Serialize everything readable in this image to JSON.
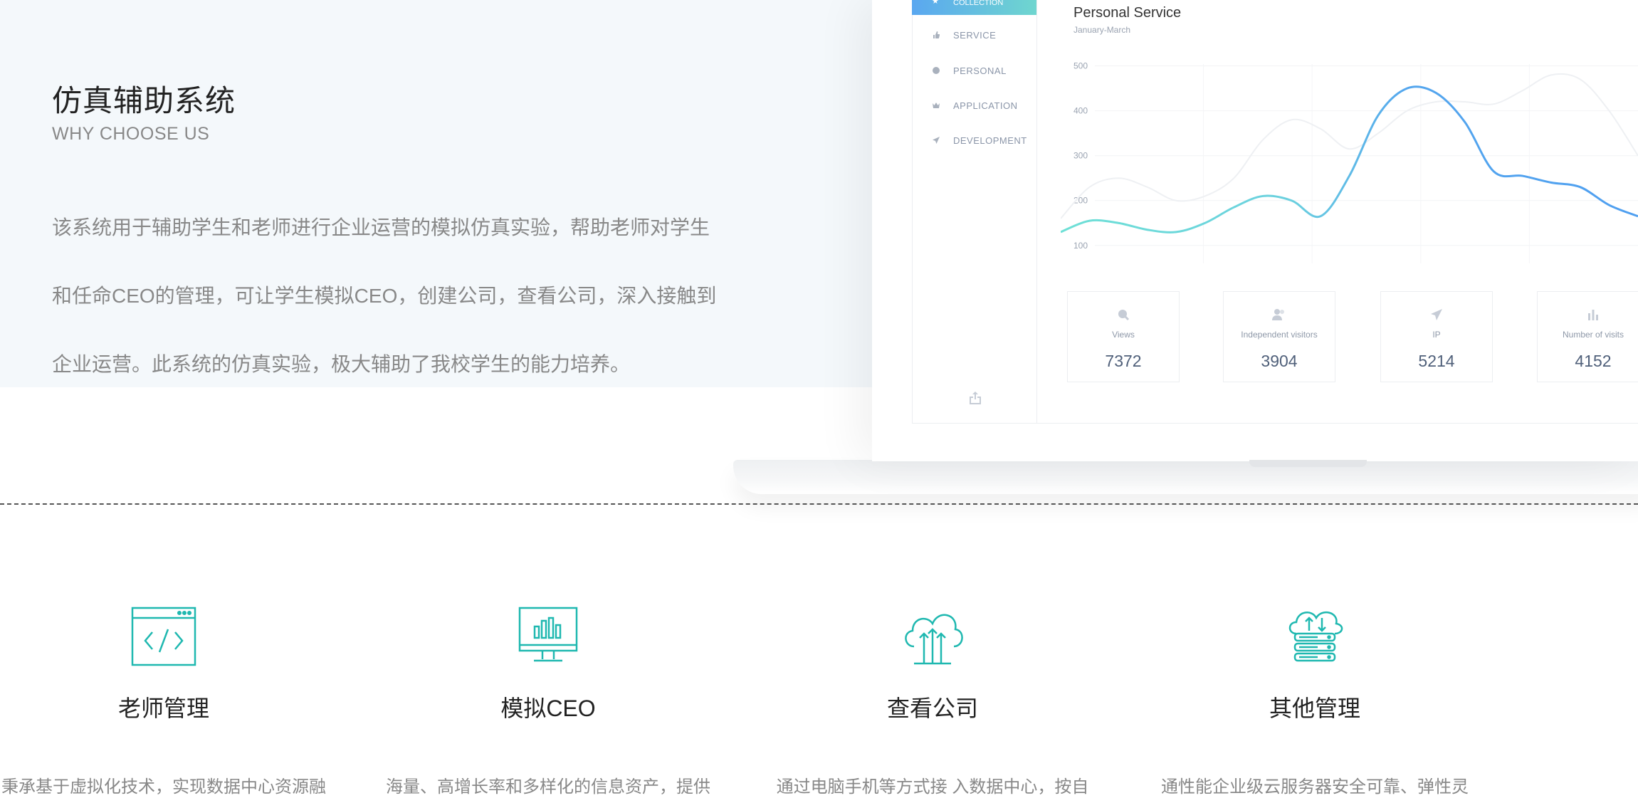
{
  "hero": {
    "title": "仿真辅助系统",
    "subtitle": "WHY CHOOSE US",
    "paragraph_lines": [
      "该系统用于辅助学生和老师进行企业运营的模拟仿真实验，帮助老师对学生",
      "和任命CEO的管理，可让学生模拟CEO，创建公司，查看公司，深入接触到",
      "企业运营。此系统的仿真实验，极大辅助了我校学生的能力培养。"
    ]
  },
  "dashboard": {
    "nav": {
      "active": "COLLECTION",
      "items": [
        "SERVICE",
        "PERSONAL",
        "APPLICATION",
        "DEVELOPMENT"
      ]
    },
    "chart_title": "Personal Service",
    "chart_subtitle": "January-March",
    "stats": [
      {
        "label": "Views",
        "value": "7372",
        "icon": "search-icon"
      },
      {
        "label": "Independent visitors",
        "value": "3904",
        "icon": "users-icon"
      },
      {
        "label": "IP",
        "value": "5214",
        "icon": "send-icon"
      },
      {
        "label": "Number of visits",
        "value": "4152",
        "icon": "bar-chart-icon"
      }
    ]
  },
  "chart_data": {
    "type": "line",
    "title": "Personal Service",
    "subtitle": "January-March",
    "yticks": [
      "500",
      "400",
      "300",
      "200",
      "100"
    ],
    "ylim": [
      60,
      520
    ],
    "grid": true,
    "series": [
      {
        "values": [
          130,
          155,
          150,
          135,
          130,
          150,
          185,
          210,
          200,
          165,
          255,
          390,
          450,
          440,
          375,
          265,
          255,
          240,
          230,
          190,
          165
        ]
      },
      {
        "values": [
          160,
          230,
          250,
          230,
          200,
          210,
          250,
          335,
          380,
          360,
          315,
          350,
          400,
          420,
          420,
          415,
          445,
          480,
          470,
          400,
          300
        ]
      }
    ],
    "colors": {
      "primary_start": "#6ee0d6",
      "primary_end": "#4f9ff0",
      "secondary": "#eef0f3"
    }
  },
  "features": [
    {
      "title": "老师管理",
      "desc": "秉承基于虚拟化技术，实现数据中心资源融",
      "icon": "code-window-icon"
    },
    {
      "title": "模拟CEO",
      "desc": "海量、高增长率和多样化的信息资产，提供",
      "icon": "monitor-chart-icon"
    },
    {
      "title": "查看公司",
      "desc": "通过电脑手机等方式接 入数据中心，按自",
      "icon": "cloud-upload-icon"
    },
    {
      "title": "其他管理",
      "desc": "通性能企业级云服务器安全可靠、弹性灵",
      "icon": "cloud-server-icon"
    }
  ],
  "colors": {
    "accent": "#1fb8b0",
    "hero_bg": "#f4f8fb"
  }
}
